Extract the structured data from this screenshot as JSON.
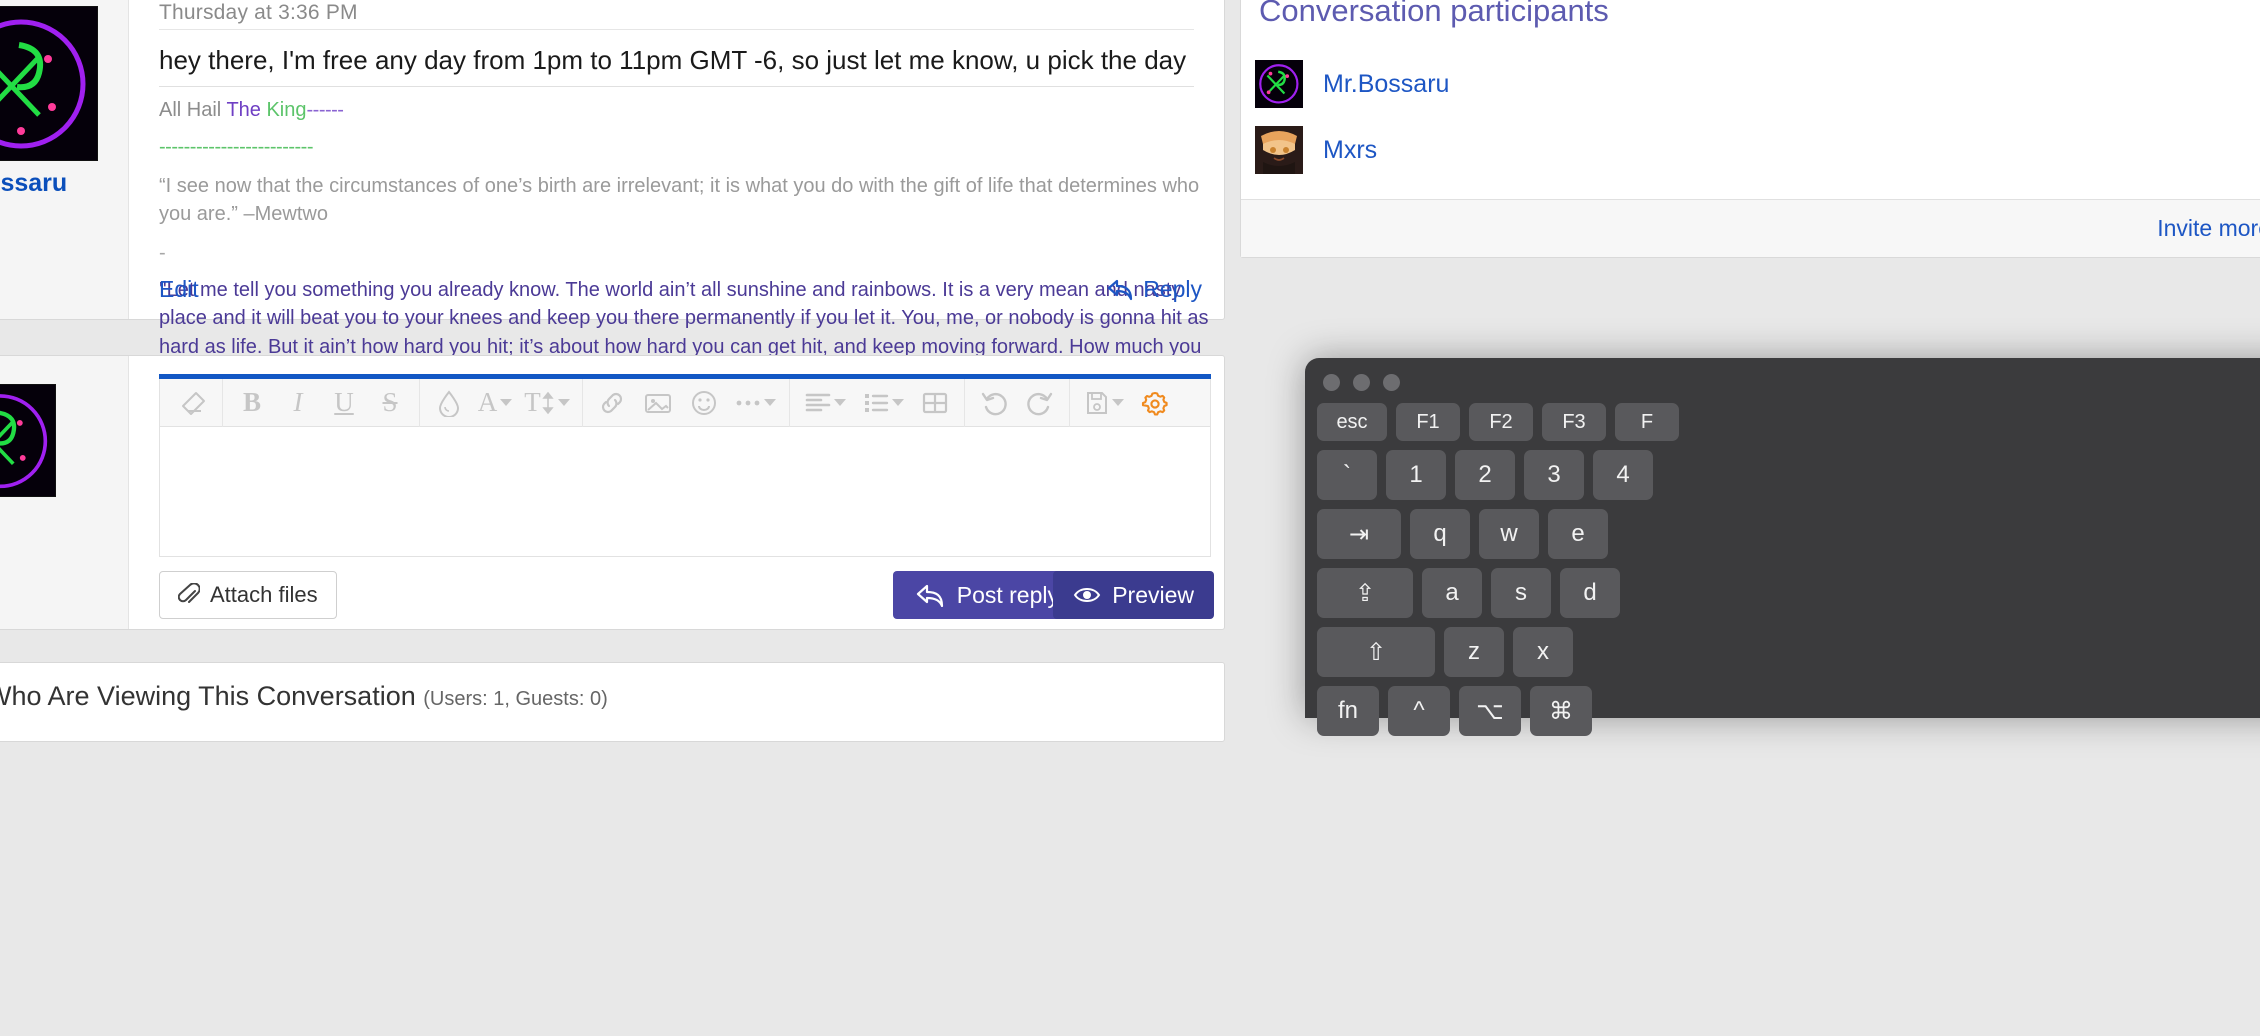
{
  "post": {
    "timestamp": "Thursday at 3:36 PM",
    "author": "Mr.Bossaru",
    "message": "hey there, I'm free any day from 1pm to 11pm GMT -6, so just let me know, u pick the day",
    "signature": {
      "line1_gray": "All Hail ",
      "line1_purple": "The ",
      "line1_green": "King",
      "line1_dashes_purple": "------",
      "line2_dashes_green": "-------------------------",
      "quote_mewtwo": "“I see now that the circumstances of one’s birth are irrelevant; it is what you do with the gift of life that determines who you are.” –Mewtwo",
      "quote_dash": "-",
      "quote_rocky": "''Let me tell you something you already know. The world ain’t all sunshine and rainbows. It is a very mean and nasty place and it will beat you to your knees and keep you there permanently if you let it. You, me, or nobody is gonna hit as hard as life. But it ain’t how hard you hit; it’s about how hard you can get hit, and keep moving forward. How much you can take, and keep moving forward. That’s how winning is done. Now, if you know what you’re worth, then go out and get what you’re worth. But you gotta be willing to take the hit, and not pointing fingers"
    },
    "edit_label": "Edit",
    "reply_label": "Reply"
  },
  "editor": {
    "toolbar": [
      {
        "name": "remove-formatting-icon",
        "glyph": "eraser"
      },
      {
        "name": "bold-icon",
        "glyph": "B"
      },
      {
        "name": "italic-icon",
        "glyph": "I"
      },
      {
        "name": "underline-icon",
        "glyph": "U"
      },
      {
        "name": "strikethrough-icon",
        "glyph": "S"
      },
      {
        "name": "text-color-icon",
        "glyph": "droplet"
      },
      {
        "name": "font-family-icon",
        "glyph": "A"
      },
      {
        "name": "font-size-icon",
        "glyph": "T"
      },
      {
        "name": "insert-link-icon",
        "glyph": "link"
      },
      {
        "name": "insert-image-icon",
        "glyph": "image"
      },
      {
        "name": "emoji-icon",
        "glyph": "smiley"
      },
      {
        "name": "more-options-icon",
        "glyph": "ellipsis"
      },
      {
        "name": "text-align-icon",
        "glyph": "align"
      },
      {
        "name": "bullet-list-icon",
        "glyph": "list"
      },
      {
        "name": "insert-table-icon",
        "glyph": "table"
      },
      {
        "name": "undo-icon",
        "glyph": "undo"
      },
      {
        "name": "redo-icon",
        "glyph": "redo"
      },
      {
        "name": "drafts-icon",
        "glyph": "floppy"
      },
      {
        "name": "editor-settings-icon",
        "glyph": "gear"
      }
    ],
    "body_value": "",
    "body_placeholder": "",
    "attach_label": "Attach files",
    "post_reply_label": "Post reply",
    "preview_label": "Preview",
    "accent_top_color": "#1257c4",
    "gear_color": "#f08a1e",
    "primary_button_color": "#4b46a5",
    "secondary_button_color": "#3b3b8f"
  },
  "viewing": {
    "title": "ers Who Are Viewing This Conversation",
    "counts": "(Users: 1, Guests: 0)"
  },
  "sidebar": {
    "title": "Conversation participants",
    "participants": [
      {
        "name": "Mr.Bossaru"
      },
      {
        "name": "Mxrs"
      }
    ],
    "invite_label": "Invite more"
  },
  "keyboard": {
    "rows": [
      [
        "esc",
        "F1",
        "F2",
        "F3",
        "F"
      ],
      [
        "`",
        "1",
        "2",
        "3",
        "4"
      ],
      [
        "⇥",
        "q",
        "w",
        "e"
      ],
      [
        "⇪",
        "a",
        "s",
        "d"
      ],
      [
        "⇧",
        "z",
        "x"
      ],
      [
        "fn",
        "^",
        "⌥",
        "⌘"
      ]
    ]
  },
  "colors": {
    "link_blue": "#1d56c4",
    "sig_purple": "#6f3fc4",
    "sig_green": "#5cc46a",
    "sig_indigo": "#4b3a96",
    "sidebar_title": "#5d5bb0"
  }
}
